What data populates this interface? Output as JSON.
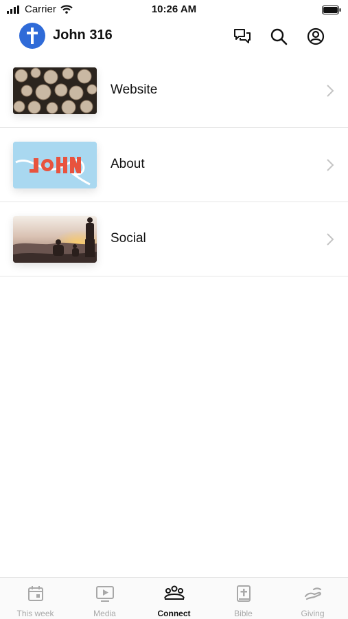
{
  "status_bar": {
    "carrier": "Carrier",
    "time": "10:26 AM"
  },
  "header": {
    "title": "John 316",
    "logo_icon": "cross-icon",
    "accent": "#2f6bd8"
  },
  "list": [
    {
      "label": "Website",
      "thumb": "wood-logs-image"
    },
    {
      "label": "About",
      "thumb": "john-lettering-image"
    },
    {
      "label": "Social",
      "thumb": "sunset-hikers-image"
    }
  ],
  "tabs": [
    {
      "label": "This week",
      "icon": "calendar-icon",
      "active": false
    },
    {
      "label": "Media",
      "icon": "play-icon",
      "active": false
    },
    {
      "label": "Connect",
      "icon": "people-icon",
      "active": true
    },
    {
      "label": "Bible",
      "icon": "bible-icon",
      "active": false
    },
    {
      "label": "Giving",
      "icon": "giving-hand-icon",
      "active": false
    }
  ]
}
